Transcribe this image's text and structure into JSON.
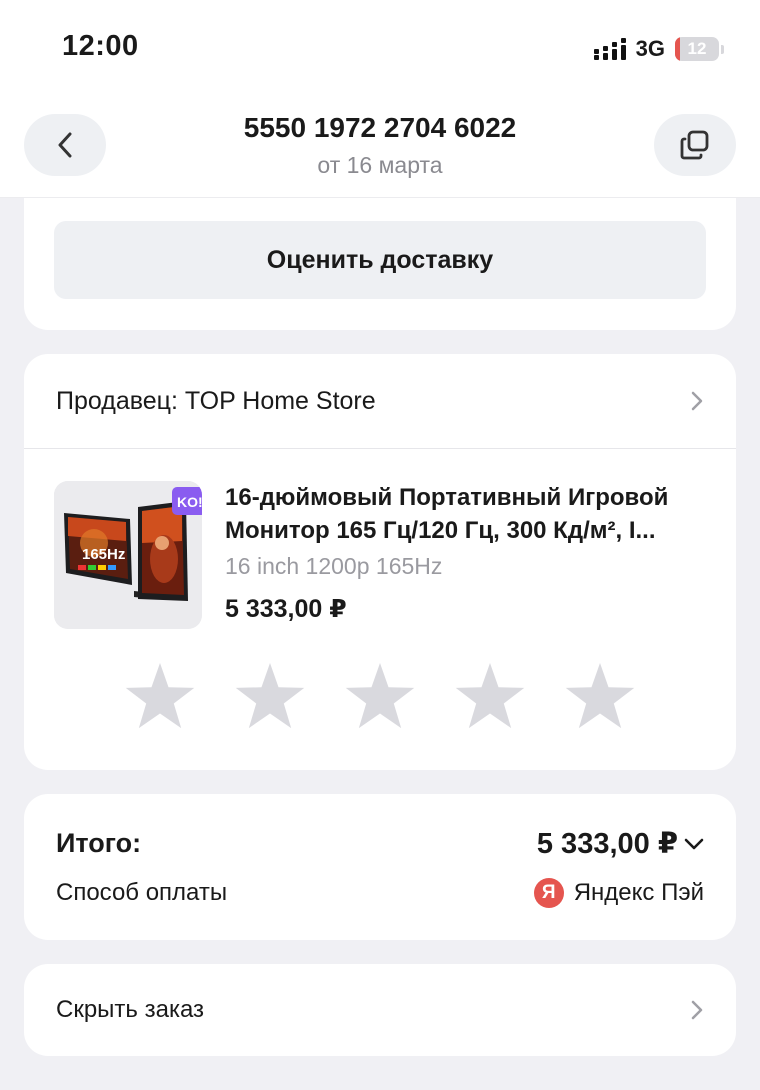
{
  "status_bar": {
    "time": "12:00",
    "network": "3G",
    "battery_level": "12",
    "battery_fraction": 0.12
  },
  "header": {
    "order_number": "5550 1972 2704 6022",
    "order_date": "от 16 марта"
  },
  "delivery": {
    "rate_button_label": "Оценить доставку"
  },
  "seller": {
    "label": "Продавец: TOP Home Store"
  },
  "product": {
    "title": "16-дюймовый Портативный Игровой Монитор 165 Гц/120 Гц, 300 Кд/м², I...",
    "variant": "16 inch 1200p 165Hz",
    "price": "5 333,00 ₽",
    "image_badge": "KO!",
    "image_overlay_text": "165Hz"
  },
  "rating": {
    "stars_total": 5,
    "stars_selected": 0
  },
  "summary": {
    "total_label": "Итого:",
    "total_value": "5 333,00 ₽",
    "payment_label": "Способ оплаты",
    "payment_icon_letter": "Я",
    "payment_method": "Яндекс Пэй"
  },
  "hide_order": {
    "label": "Скрыть заказ"
  },
  "colors": {
    "background": "#f0f0f4",
    "card": "#ffffff",
    "button_bg": "#eef0f3",
    "star_inactive": "#d9d9de",
    "yandex_red": "#e5554f",
    "muted_text": "#8a8a90"
  }
}
